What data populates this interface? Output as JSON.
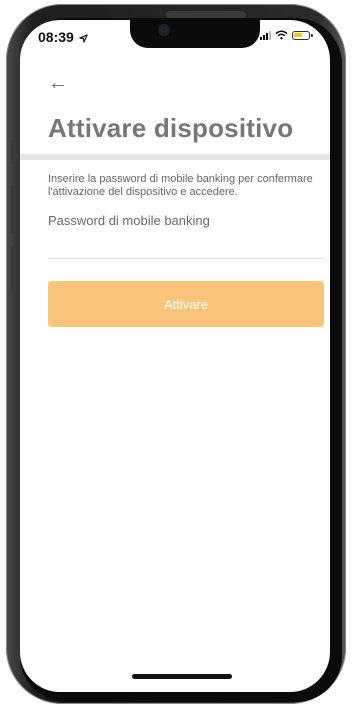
{
  "status_bar": {
    "time": "08:39",
    "location_icon": "location-arrow-icon",
    "signal_icon": "signal-icon",
    "wifi_icon": "wifi-icon",
    "battery_icon": "battery-icon"
  },
  "header": {
    "back_icon": "back-arrow-icon",
    "back_glyph": "←",
    "title": "Attivare dispositivo"
  },
  "form": {
    "description": "Inserire la password di mobile banking per confermare l'attivazione del dispositivo e accedere.",
    "password_label": "Password di mobile banking",
    "password_value": "",
    "submit_label": "Attivare"
  },
  "colors": {
    "button_bg": "#f8c47a",
    "title": "#777777",
    "divider": "#e6e6e6"
  }
}
